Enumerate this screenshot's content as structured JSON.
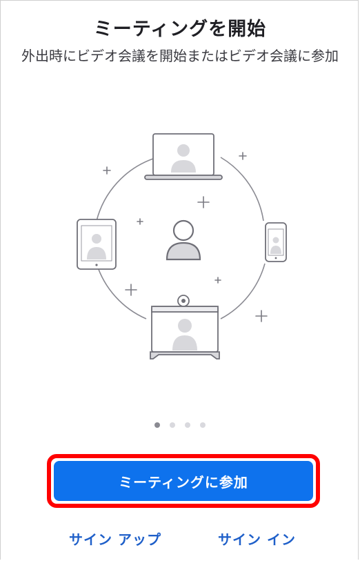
{
  "header": {
    "title": "ミーティングを開始",
    "subtitle": "外出時にビデオ会議を開始またはビデオ会議に参加"
  },
  "carousel": {
    "page_count": 4,
    "active_index": 0
  },
  "actions": {
    "join_label": "ミーティングに参加",
    "signup_label": "サイン アップ",
    "signin_label": "サイン イン"
  },
  "colors": {
    "primary": "#0e72ed",
    "link": "#1e5fc9",
    "highlight": "#ff0000",
    "illustration_stroke": "#7a7a82",
    "illustration_fill": "#d8d8dc"
  },
  "icons": {
    "laptop": "laptop-icon",
    "tablet": "tablet-icon",
    "phone": "phone-icon",
    "room_system": "room-system-icon",
    "user": "user-icon"
  }
}
